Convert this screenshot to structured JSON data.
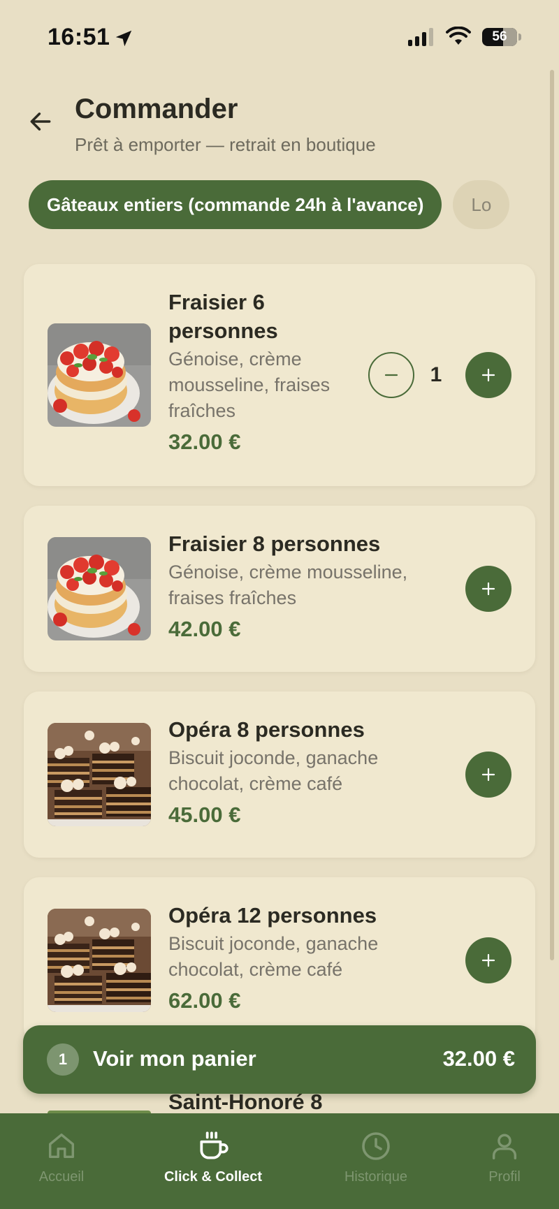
{
  "status_bar": {
    "time": "16:51",
    "battery": "56"
  },
  "header": {
    "title": "Commander",
    "subtitle": "Prêt à emporter — retrait en boutique"
  },
  "categories": [
    {
      "label": "Gâteaux entiers (commande 24h à l'avance)",
      "active": true
    },
    {
      "label": "Lo",
      "active": false
    }
  ],
  "products": [
    {
      "name": "Fraisier 6 personnes",
      "description": "Génoise, crème mousseline, fraises fraîches",
      "price": "32.00 €",
      "quantity": "1",
      "image": "strawberry-cake"
    },
    {
      "name": "Fraisier 8 personnes",
      "description": "Génoise, crème mousseline, fraises fraîches",
      "price": "42.00 €",
      "image": "strawberry-cake"
    },
    {
      "name": "Opéra 8 personnes",
      "description": "Biscuit joconde, ganache chocolat, crème café",
      "price": "45.00 €",
      "image": "opera-cake"
    },
    {
      "name": "Opéra 12 personnes",
      "description": "Biscuit joconde, ganache chocolat, crème café",
      "price": "62.00 €",
      "image": "opera-cake"
    }
  ],
  "partial_item": {
    "name": "Saint-Honoré 8"
  },
  "cart": {
    "count": "1",
    "label": "Voir mon panier",
    "total": "32.00 €"
  },
  "tabs": [
    {
      "label": "Accueil",
      "icon": "home-icon",
      "active": false
    },
    {
      "label": "Click & Collect",
      "icon": "coffee-cup-icon",
      "active": true
    },
    {
      "label": "Historique",
      "icon": "clock-icon",
      "active": false
    },
    {
      "label": "Profil",
      "icon": "user-icon",
      "active": false
    }
  ],
  "colors": {
    "brand_green": "#4a6b39",
    "background": "#e8dfc5",
    "card": "#f0e8cf"
  }
}
